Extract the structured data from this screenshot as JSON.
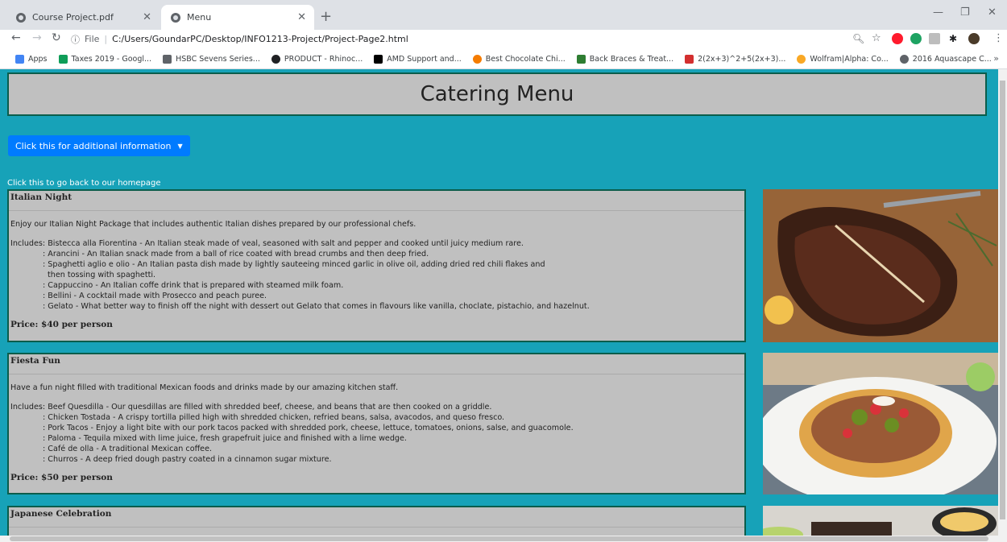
{
  "browser": {
    "tabs": [
      {
        "title": "Course Project.pdf",
        "active": false
      },
      {
        "title": "Menu",
        "active": true
      }
    ],
    "address": {
      "scheme_label": "File",
      "url": "C:/Users/GoundarPC/Desktop/INFO1213-Project/Project-Page2.html"
    },
    "bookmarks": [
      {
        "label": "Apps",
        "color": "#4285f4"
      },
      {
        "label": "Taxes 2019 - Googl...",
        "color": "#0f9d58"
      },
      {
        "label": "HSBC Sevens Series...",
        "color": "#5f6368"
      },
      {
        "label": "PRODUCT - Rhinoc...",
        "color": "#202124"
      },
      {
        "label": "AMD Support and...",
        "color": "#000000"
      },
      {
        "label": "Best Chocolate Chi...",
        "color": "#f57c00"
      },
      {
        "label": "Back Braces & Treat...",
        "color": "#2e7d32"
      },
      {
        "label": "2(2x+3)^2+5(2x+3)...",
        "color": "#d32f2f"
      },
      {
        "label": "Wolfram|Alpha: Co...",
        "color": "#f9a825"
      },
      {
        "label": "2016 Aquascape C...",
        "color": "#5f6368"
      }
    ]
  },
  "page": {
    "title": "Catering Menu",
    "dropdown_label": "Click this for additional information",
    "home_link": "Click this to go back to our homepage",
    "background": "#17a2b8",
    "menus": [
      {
        "name": "Italian Night",
        "description": "Enjoy our Italian Night Package that includes authentic Italian dishes prepared by our professional chefs.",
        "includes": [
          "Includes: Bistecca alla Fiorentina - An Italian steak made of veal, seasoned with salt and pepper and cooked until juicy medium rare.",
          ": Arancini - An Italian snack made from a ball of rice coated with bread crumbs and then deep fried.",
          ": Spaghetti aglio e olio - An Italian pasta dish made by lightly sauteeing minced garlic in olive oil, adding dried red chili flakes and",
          "then tossing with spaghetti.",
          ": Cappuccino - An Italian coffe drink that is prepared with steamed milk foam.",
          ": Bellini -  A cocktail made with Prosecco and peach puree.",
          ": Gelato -  What better way to finish off the night with dessert out Gelato that comes in flavours like vanilla, choclate, pistachio, and hazelnut."
        ],
        "price": "Price: $40 per person",
        "image": "grilled-steak"
      },
      {
        "name": "Fiesta Fun",
        "description": "Have a fun night filled with traditional Mexican foods and drinks made by our amazing kitchen staff.",
        "includes": [
          "Includes: Beef Quesdilla - Our quesdillas are filled with shredded beef, cheese, and beans that are then cooked on a griddle.",
          ": Chicken Tostada - A crispy tortilla pilled high with shredded chicken, refried beans, salsa, avacodos, and queso fresco.",
          ": Pork Tacos - Enjoy a light bite with our pork tacos packed with shredded pork, cheese, lettuce, tomatoes, onions, salse, and guacomole.",
          ": Paloma - Tequila mixed with lime juice, fresh grapefruit juice and finished with a lime wedge.",
          ": Café de olla - A traditional Mexican coffee.",
          ": Churros - A deep fried dough pastry coated in a cinnamon sugar mixture."
        ],
        "price": "Price: $50 per person",
        "image": "tostada"
      },
      {
        "name": "Japanese Celebration",
        "image": "japanese-dish"
      }
    ]
  }
}
